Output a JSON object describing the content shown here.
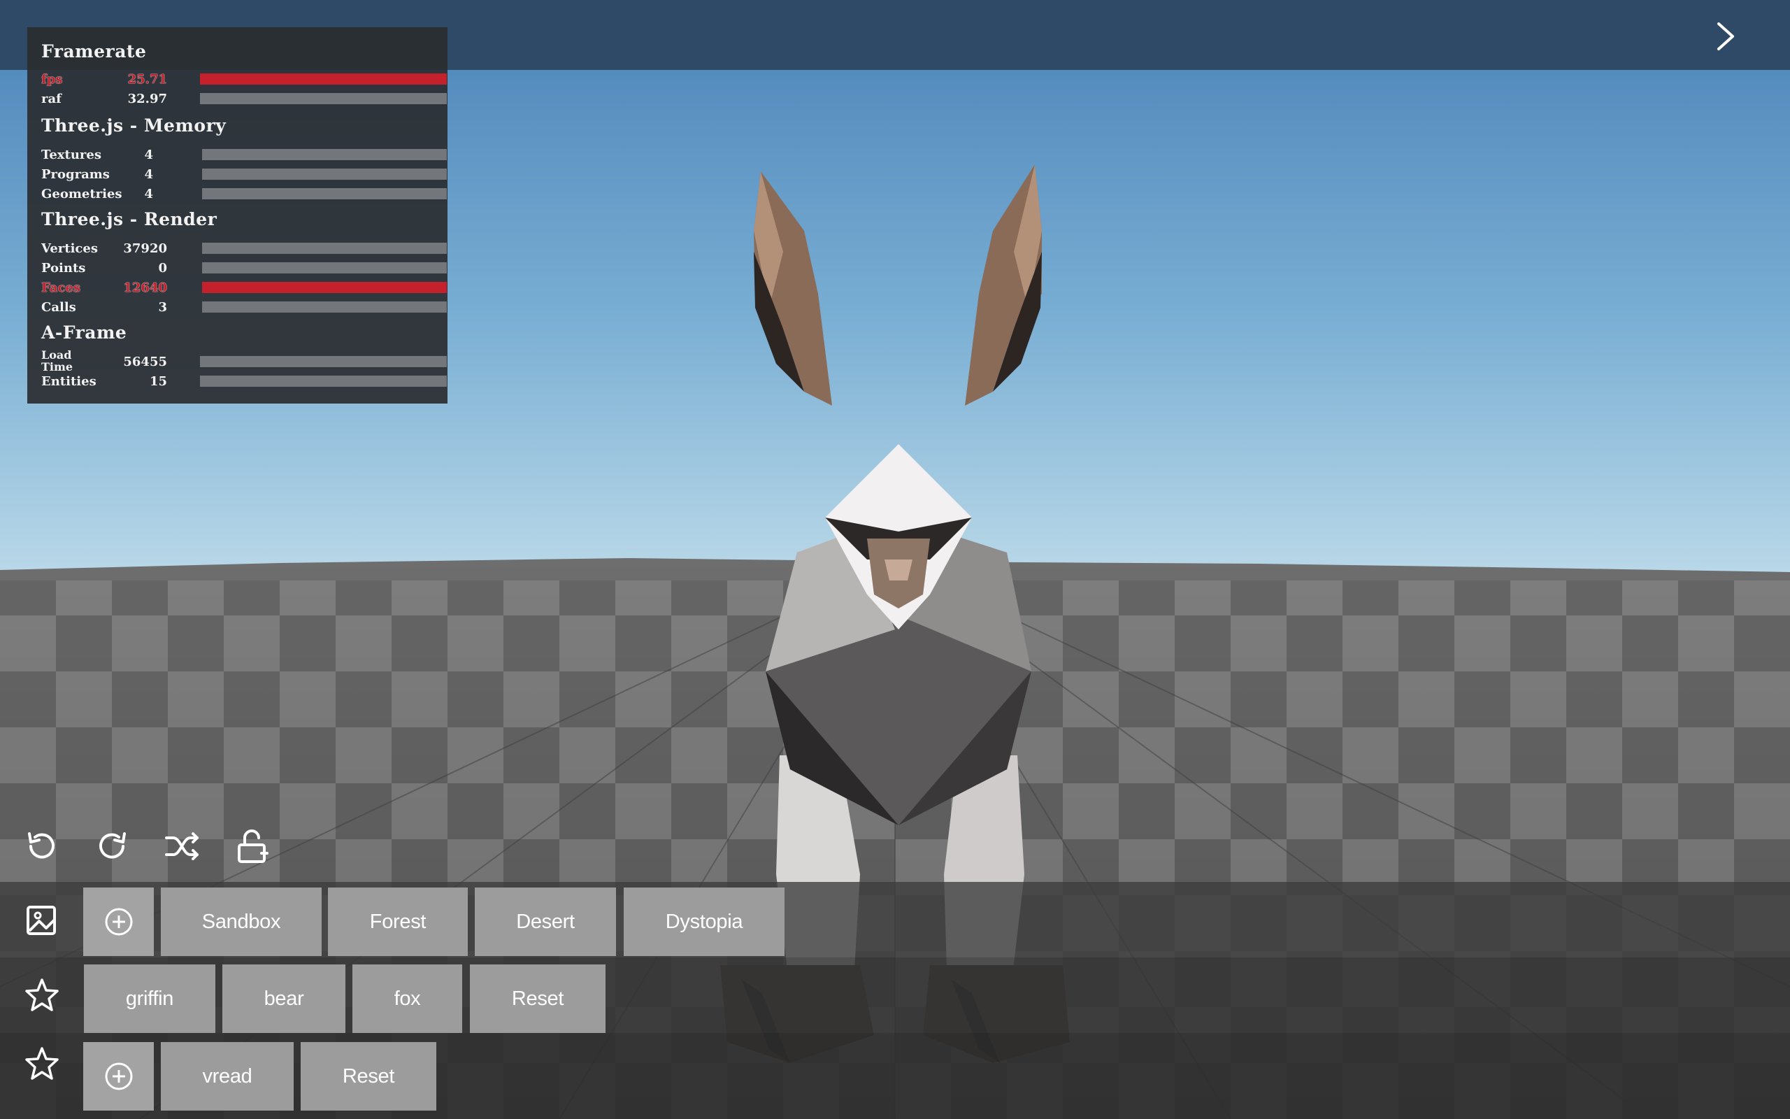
{
  "stats": {
    "framerate": {
      "title": "Framerate",
      "fps": {
        "label": "fps",
        "value": "25.71",
        "level": 1.0
      },
      "raf": {
        "label": "raf",
        "value": "32.97",
        "level": 0.0
      }
    },
    "memory": {
      "title": "Three.js - Memory",
      "textures": {
        "label": "Textures",
        "value": "4",
        "level": 0.0
      },
      "programs": {
        "label": "Programs",
        "value": "4",
        "level": 0.0
      },
      "geometries": {
        "label": "Geometries",
        "value": "4",
        "level": 0.0
      }
    },
    "render": {
      "title": "Three.js - Render",
      "vertices": {
        "label": "Vertices",
        "value": "37920",
        "level": 0.0
      },
      "points": {
        "label": "Points",
        "value": "0",
        "level": 0.0
      },
      "faces": {
        "label": "Faces",
        "value": "12640",
        "level": 1.0
      },
      "calls": {
        "label": "Calls",
        "value": "3",
        "level": 0.0
      }
    },
    "aframe": {
      "title": "A-Frame",
      "load_time": {
        "label_line1": "Load",
        "label_line2": "Time",
        "value": "56455",
        "level": 0.0
      },
      "entities": {
        "label": "Entities",
        "value": "15",
        "level": 0.0
      }
    }
  },
  "toolbar": {
    "icons": [
      "undo-icon",
      "redo-icon",
      "shuffle-icon",
      "unlock-icon"
    ]
  },
  "environments": {
    "row_icon": "image-icon",
    "add_icon": "plus-circle-icon",
    "items": [
      "Sandbox",
      "Forest",
      "Desert",
      "Dystopia"
    ]
  },
  "models": {
    "row_icon": "star-icon",
    "items": [
      "griffin",
      "bear",
      "fox",
      "Reset"
    ]
  },
  "custom": {
    "row_icon": "star-icon",
    "add_icon": "plus-circle-icon",
    "items": [
      "vread",
      "Reset"
    ]
  },
  "colors": {
    "sky_top": "#4f86bb",
    "sky_horizon": "#b7d5e6",
    "alert": "#c5212c",
    "topbar": "#2f4a66"
  }
}
